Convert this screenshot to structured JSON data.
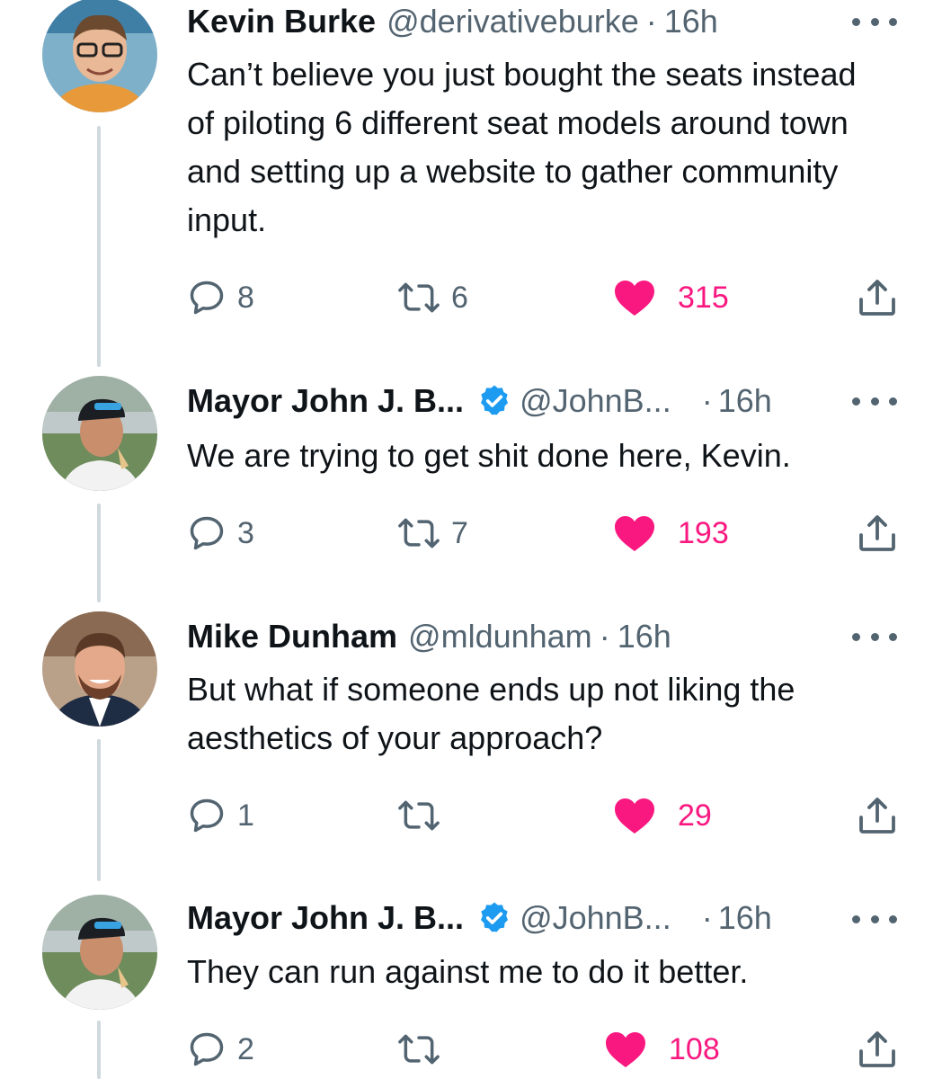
{
  "tweets": [
    {
      "name": "Kevin Burke",
      "handle": "@derivativeburke",
      "dot": "·",
      "time": "16h",
      "verified": false,
      "text": "Can’t believe you just bought the seats instead of piloting 6 different seat models around town and setting up a website to gather community input.",
      "replies": "8",
      "retweets": "6",
      "likes": "315"
    },
    {
      "name": "Mayor John J. B...",
      "handle": "@JohnB...",
      "dot": "·",
      "time": "16h",
      "verified": true,
      "text": "We are trying to get shit done here, Kevin.",
      "replies": "3",
      "retweets": "7",
      "likes": "193"
    },
    {
      "name": "Mike Dunham",
      "handle": "@mldunham",
      "dot": "·",
      "time": "16h",
      "verified": false,
      "text": "But what if someone ends up not liking the aesthetics of your approach?",
      "replies": "1",
      "retweets": "",
      "likes": "29"
    },
    {
      "name": "Mayor John J. B...",
      "handle": "@JohnB...",
      "dot": "·",
      "time": "16h",
      "verified": true,
      "text": "They can run against me to do it better.",
      "replies": "2",
      "retweets": "",
      "likes": "108"
    }
  ],
  "colors": {
    "like": "#f91880",
    "verified": "#1d9bf0",
    "muted": "#536471",
    "thread_line": "#cfd9de"
  },
  "icons": [
    "reply-icon",
    "retweet-icon",
    "heart-icon",
    "share-icon",
    "more-icon",
    "verified-badge-icon"
  ]
}
